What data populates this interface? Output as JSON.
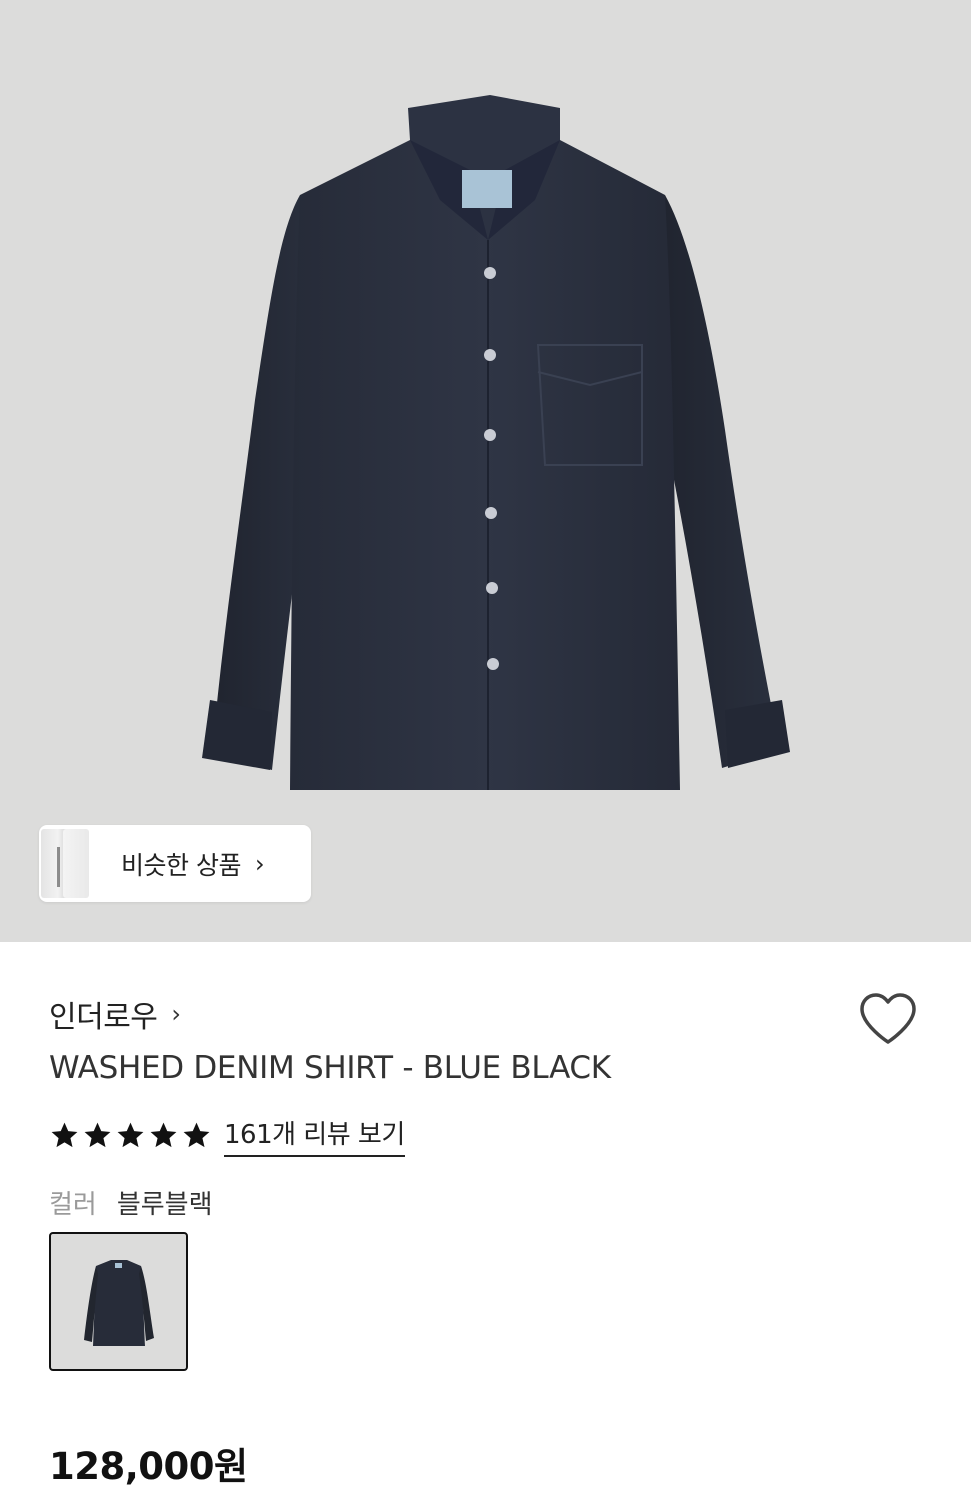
{
  "hero": {
    "similar_button_label": "비슷한 상품",
    "similar_button_chevron": "›",
    "background_color": "#dcdcdb"
  },
  "product": {
    "brand": "인더로우",
    "brand_chevron": "›",
    "title": "WASHED DENIM SHIRT - BLUE BLACK",
    "rating_stars": 5,
    "review_link": "161개 리뷰 보기",
    "color_label": "컬러",
    "color_value": "블루블랙",
    "price": "128,000원",
    "wishlist_icon": "heart-outline-icon"
  },
  "colors": {
    "shirt": "#2b3140",
    "shirt_dark": "#1f2430",
    "accent_text": "#222222"
  }
}
